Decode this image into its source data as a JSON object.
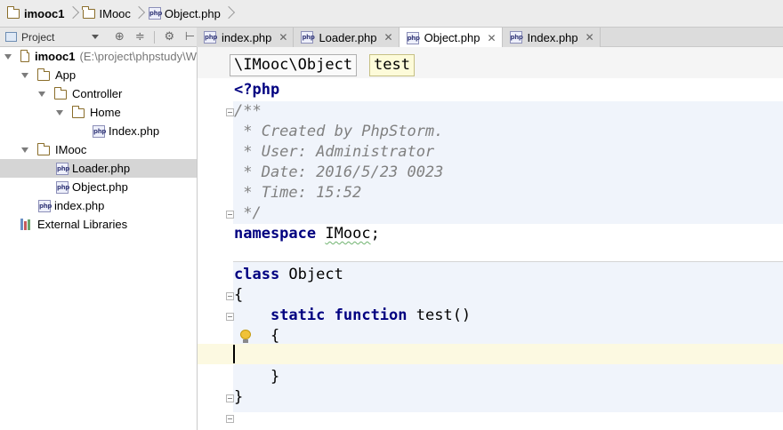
{
  "breadcrumb": {
    "items": [
      "imooc1",
      "IMooc",
      "Object.php"
    ]
  },
  "project_panel": {
    "title": "Project"
  },
  "tabs": [
    {
      "label": "index.php",
      "active": false
    },
    {
      "label": "Loader.php",
      "active": false
    },
    {
      "label": "Object.php",
      "active": true
    },
    {
      "label": "Index.php",
      "active": false
    }
  ],
  "tree": {
    "root": {
      "name": "imooc1",
      "path": "(E:\\project\\phpstudy\\W"
    },
    "items": [
      {
        "name": "App",
        "type": "folder"
      },
      {
        "name": "Controller",
        "type": "folder"
      },
      {
        "name": "Home",
        "type": "folder"
      },
      {
        "name": "Index.php",
        "type": "php"
      },
      {
        "name": "IMooc",
        "type": "folder"
      },
      {
        "name": "Loader.php",
        "type": "php",
        "selected": true
      },
      {
        "name": "Object.php",
        "type": "php"
      },
      {
        "name": "index.php",
        "type": "php"
      },
      {
        "name": "External Libraries",
        "type": "library"
      }
    ]
  },
  "editor": {
    "nav_namespace": "\\IMooc\\Object",
    "nav_function": "test",
    "code": {
      "open_tag": "<?php",
      "doc_start": "/**",
      "doc_created": " * Created by PhpStorm.",
      "doc_user": " * User: Administrator",
      "doc_date": " * Date: 2016/5/23 0023",
      "doc_time": " * Time: 15:52",
      "doc_end": " */",
      "ns_keyword": "namespace",
      "ns_name": "IMooc",
      "ns_end": ";",
      "class_keyword": "class",
      "class_name": " Object",
      "brace_open": "{",
      "method_static": "static",
      "method_function": "function",
      "method_name": " test()",
      "method_brace_open": "    {",
      "method_brace_close": "    }",
      "brace_close": "}"
    }
  },
  "colors": {
    "keyword": "#000080",
    "comment": "#808080",
    "caret_line": "#fcf9e1",
    "selection": "#d5d5d5"
  }
}
